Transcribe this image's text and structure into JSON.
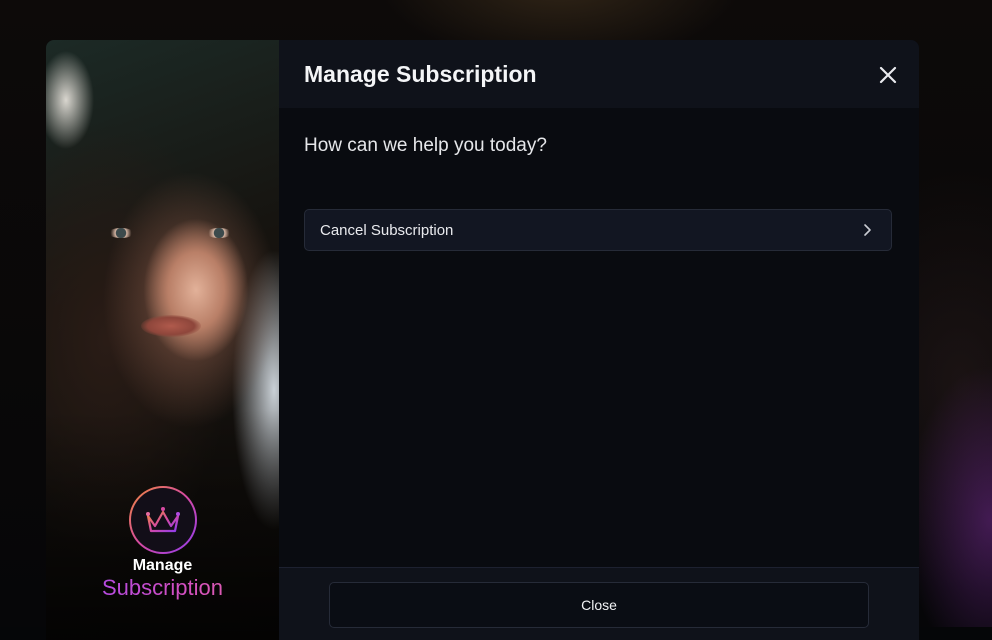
{
  "modal": {
    "title": "Manage Subscription",
    "prompt": "How can we help you today?",
    "options": [
      {
        "label": "Cancel Subscription",
        "icon": "chevron-right-icon"
      }
    ],
    "close_icon": "close-icon",
    "footer": {
      "close_label": "Close"
    }
  },
  "side_panel": {
    "brand_line1": "Manage",
    "brand_line2": "Subscription",
    "badge_icon": "crown-icon"
  },
  "colors": {
    "accent_start": "#f08a3a",
    "accent_mid": "#d64aa3",
    "accent_end": "#8e3cf0",
    "panel_bg": "#090b10",
    "header_bg": "#0f121a",
    "option_bg": "#121622"
  }
}
